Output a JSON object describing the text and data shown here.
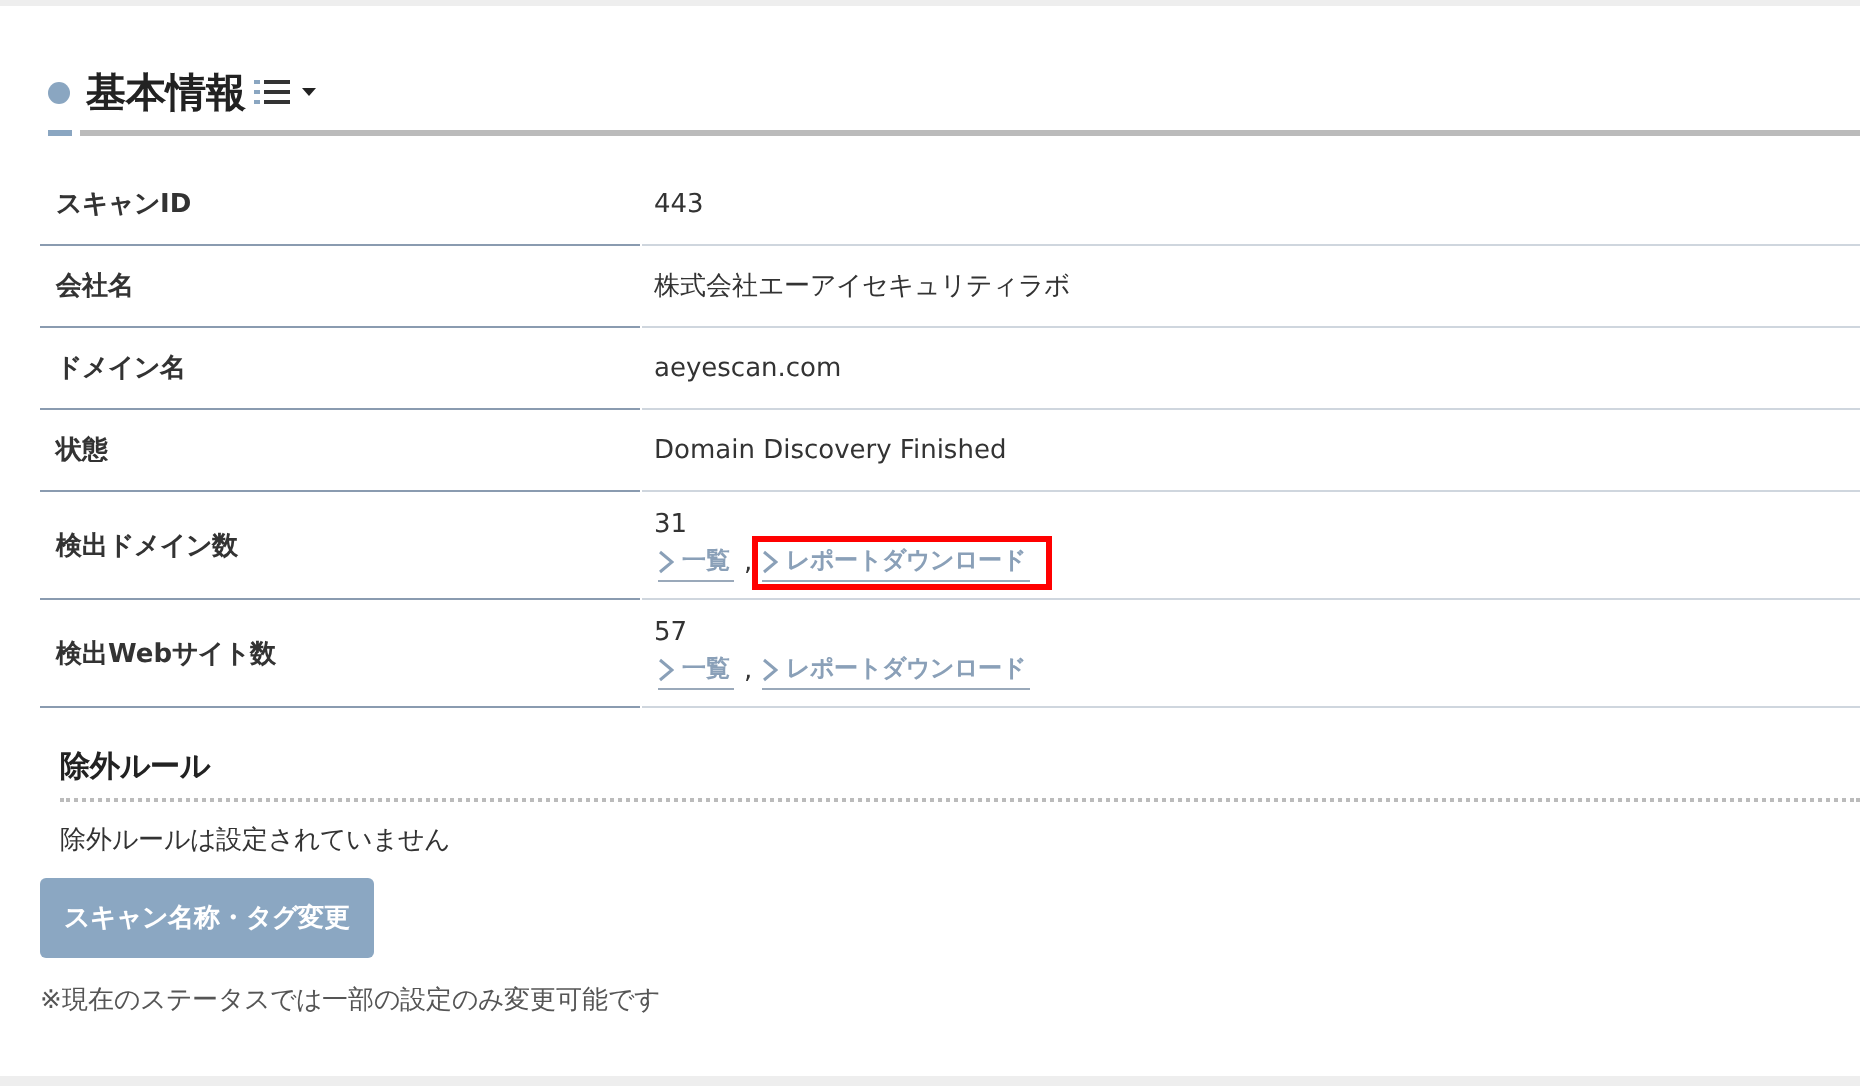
{
  "section": {
    "title": "基本情報"
  },
  "rows": [
    {
      "label": "スキャンID",
      "value": "443"
    },
    {
      "label": "会社名",
      "value": "株式会社エーアイセキュリティラボ"
    },
    {
      "label": "ドメイン名",
      "value": "aeyescan.com"
    },
    {
      "label": "状態",
      "value": "Domain Discovery Finished"
    },
    {
      "label": "検出ドメイン数",
      "value": "31",
      "separator": ",",
      "links": [
        {
          "label": "一覧",
          "highlighted": false
        },
        {
          "label": "レポートダウンロード",
          "highlighted": true
        }
      ]
    },
    {
      "label": "検出Webサイト数",
      "value": "57",
      "separator": ",",
      "links": [
        {
          "label": "一覧",
          "highlighted": false
        },
        {
          "label": "レポートダウンロード",
          "highlighted": false
        }
      ]
    }
  ],
  "exclusion": {
    "title": "除外ルール",
    "message": "除外ルールは設定されていません"
  },
  "button": {
    "label": "スキャン名称・タグ変更",
    "disabled": true
  },
  "note": "※現在のステータスでは一部の設定のみ変更可能です"
}
